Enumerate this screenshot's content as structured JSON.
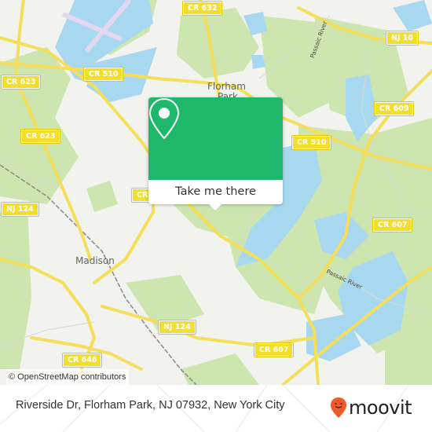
{
  "map": {
    "road_shields": [
      {
        "label": "CR 632"
      },
      {
        "label": "NJ 10"
      },
      {
        "label": "CR 623"
      },
      {
        "label": "CR 510"
      },
      {
        "label": "CR 623"
      },
      {
        "label": "CR 609"
      },
      {
        "label": "CR 510"
      },
      {
        "label": "CR"
      },
      {
        "label": "NJ 124"
      },
      {
        "label": "CR 607"
      },
      {
        "label": "NJ 124"
      },
      {
        "label": "CR 607"
      },
      {
        "label": "CR 646"
      }
    ],
    "places": [
      {
        "label": "Florham"
      },
      {
        "label": "Park"
      },
      {
        "label": "Madison"
      }
    ],
    "rivers": [
      {
        "label": "Passaic River"
      },
      {
        "label": "Passaic River"
      }
    ],
    "attribution": "© OpenStreetMap contributors",
    "colors": {
      "land": "#f2f2ee",
      "park": "#cde6b0",
      "water": "#a8d8ef",
      "road": "#f4de5a",
      "popup": "#1fb86a"
    }
  },
  "popup": {
    "icon": "map-pin-icon",
    "button_label": "Take me there"
  },
  "footer": {
    "address": "Riverside Dr, Florham Park, NJ 07932, New York City",
    "brand": "moovit",
    "brand_icon": "moovit-pin-icon",
    "brand_color": "#f05a28"
  }
}
